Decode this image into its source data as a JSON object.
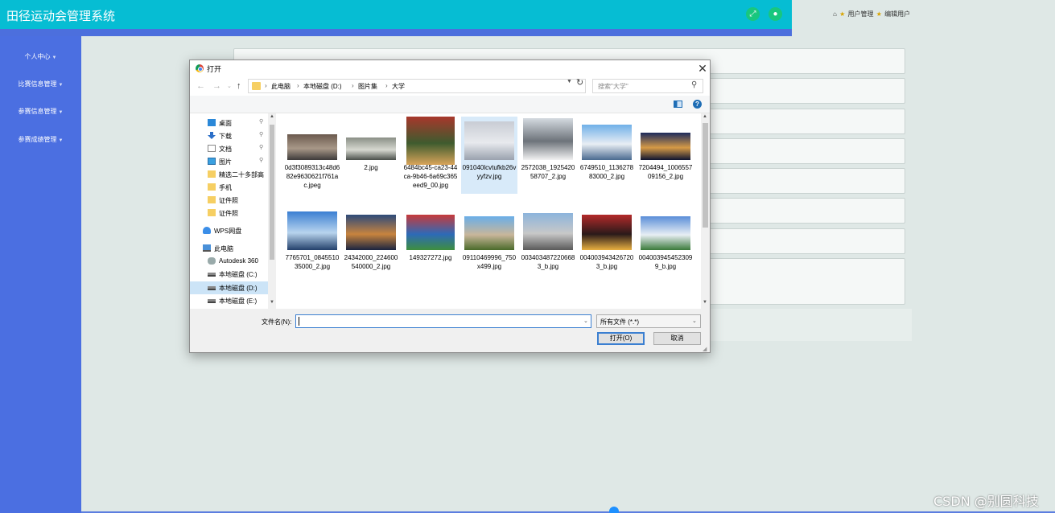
{
  "app": {
    "title": "田径运动会管理系统",
    "header_icons": [
      "fullscreen-icon",
      "user-icon"
    ],
    "breadcrumb": [
      "用户管理",
      "编辑用户"
    ]
  },
  "sidebar": {
    "items": [
      {
        "label": "个人中心"
      },
      {
        "label": "比赛信息管理"
      },
      {
        "label": "参赛信息管理"
      },
      {
        "label": "参赛成绩管理"
      }
    ]
  },
  "dialog": {
    "title": "打开",
    "address": [
      "此电脑",
      "本地磁盘 (D:)",
      "图片集",
      "大学"
    ],
    "search_placeholder": "搜索\"大学\"",
    "nav_tree": [
      {
        "label": "桌面",
        "icon": "desktop-icon",
        "pinned": true
      },
      {
        "label": "下载",
        "icon": "download-icon",
        "pinned": true
      },
      {
        "label": "文档",
        "icon": "document-icon",
        "pinned": true
      },
      {
        "label": "图片",
        "icon": "picture-icon",
        "pinned": true
      },
      {
        "label": "精选二十多部高",
        "icon": "folder-icon",
        "pinned": false
      },
      {
        "label": "手机",
        "icon": "folder-icon",
        "pinned": false
      },
      {
        "label": "证件照",
        "icon": "folder-icon",
        "pinned": false
      },
      {
        "label": "证件照",
        "icon": "folder-icon",
        "pinned": false
      },
      {
        "label": "WPS网盘",
        "icon": "cloud-icon",
        "pinned": false
      },
      {
        "label": "此电脑",
        "icon": "computer-icon",
        "pinned": false
      },
      {
        "label": "Autodesk 360",
        "icon": "cloud-drive-icon",
        "pinned": false
      },
      {
        "label": "本地磁盘 (C:)",
        "icon": "drive-icon",
        "pinned": false
      },
      {
        "label": "本地磁盘 (D:)",
        "icon": "drive-icon",
        "pinned": false,
        "selected": true
      },
      {
        "label": "本地磁盘 (E:)",
        "icon": "drive-icon",
        "pinned": false
      }
    ],
    "files": [
      {
        "name": "0d3f3089313c48d682e9630621f761ac.jpeg",
        "colors": [
          "#6b5a4e",
          "#a89888",
          "#3d3a3a"
        ]
      },
      {
        "name": "2.jpg",
        "colors": [
          "#8a8f86",
          "#d6d8d0",
          "#4a4f4a"
        ]
      },
      {
        "name": "6484bc45-ca23-44ca-9b46-6a69c365eed9_00.jpg",
        "colors": [
          "#a8372c",
          "#3e5b2e",
          "#d8a45a"
        ]
      },
      {
        "name": "091040lcvtufkb26vyyfzv.jpg",
        "colors": [
          "#c8ccd4",
          "#e8eaee",
          "#9aa2ae"
        ],
        "selected": true
      },
      {
        "name": "2572038_192542058707_2.jpg",
        "colors": [
          "#d4dae0",
          "#6d737a",
          "#f2f2f2"
        ]
      },
      {
        "name": "6749510_113627883000_2.jpg",
        "colors": [
          "#6fb0e8",
          "#e8eef4",
          "#4a6a90"
        ]
      },
      {
        "name": "7204494_100655709156_2.jpg",
        "colors": [
          "#1c2a5c",
          "#d69a46",
          "#0e1430"
        ]
      },
      {
        "name": "7765701_084551035000_2.jpg",
        "colors": [
          "#3a7fd2",
          "#b8d4ee",
          "#23406b"
        ]
      },
      {
        "name": "24342000_224600540000_2.jpg",
        "colors": [
          "#2c4a7a",
          "#c8843e",
          "#1a2440"
        ]
      },
      {
        "name": "149327272.jpg",
        "colors": [
          "#c83a3a",
          "#2d6ab8",
          "#3e8e3e"
        ]
      },
      {
        "name": "09110469996_750x499.jpg",
        "colors": [
          "#6aaee8",
          "#c8b69a",
          "#4a6a2a"
        ]
      },
      {
        "name": "0034034872206683_b.jpg",
        "colors": [
          "#8cb4dc",
          "#c8c8c8",
          "#5a5a5a"
        ]
      },
      {
        "name": "0040039434267203_b.jpg",
        "colors": [
          "#b42a2a",
          "#2a1a1a",
          "#e8b040"
        ]
      },
      {
        "name": "0040039454523099_b.jpg",
        "colors": [
          "#5a8ed8",
          "#e8eef4",
          "#3a7a3a"
        ]
      },
      {
        "name": "",
        "colors": [
          "#b0a898",
          "#6a6458",
          "#e0dcd4"
        ]
      },
      {
        "name": "",
        "colors": [
          "#a8c8e0",
          "#4a7a5a",
          "#e8eef2"
        ]
      },
      {
        "name": "",
        "colors": [
          "#2a5a9a",
          "#c8d8ea",
          "#1a3050"
        ]
      },
      {
        "name": "",
        "colors": [
          "#4a6a8a",
          "#3a3a3a",
          "#8aa2ba"
        ]
      },
      {
        "name": "",
        "colors": [
          "#e8e0d0",
          "#b0a088",
          "#7ab0e0"
        ]
      },
      {
        "name": "",
        "colors": [
          "#c89a3a",
          "#8a5a2a",
          "#e8d09a"
        ]
      },
      {
        "name": "",
        "colors": [
          "#3a7ae0",
          "#e8eef6",
          "#c8a060"
        ]
      }
    ],
    "filename_label": "文件名(N):",
    "filename_value": "",
    "filetype": "所有文件 (*.*)",
    "open_button": "打开(O)",
    "cancel_button": "取消"
  },
  "watermark": "CSDN @别圆科技"
}
